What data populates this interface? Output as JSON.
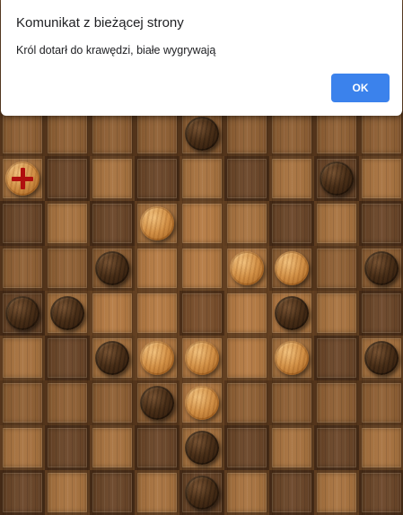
{
  "dialog": {
    "title": "Komunikat z bieżącej strony",
    "message": "Król dotarł do krawędzi, białe wygrywają",
    "ok_label": "OK"
  },
  "board": {
    "size": 9,
    "pieces": [
      {
        "row": 0,
        "col": 4,
        "color": "black"
      },
      {
        "row": 1,
        "col": 0,
        "color": "king"
      },
      {
        "row": 1,
        "col": 7,
        "color": "black"
      },
      {
        "row": 2,
        "col": 3,
        "color": "white"
      },
      {
        "row": 3,
        "col": 2,
        "color": "black"
      },
      {
        "row": 3,
        "col": 5,
        "color": "white"
      },
      {
        "row": 3,
        "col": 6,
        "color": "white"
      },
      {
        "row": 3,
        "col": 8,
        "color": "black"
      },
      {
        "row": 4,
        "col": 0,
        "color": "black"
      },
      {
        "row": 4,
        "col": 1,
        "color": "black"
      },
      {
        "row": 4,
        "col": 6,
        "color": "black"
      },
      {
        "row": 5,
        "col": 2,
        "color": "black"
      },
      {
        "row": 5,
        "col": 3,
        "color": "white"
      },
      {
        "row": 5,
        "col": 4,
        "color": "white"
      },
      {
        "row": 5,
        "col": 6,
        "color": "white"
      },
      {
        "row": 5,
        "col": 8,
        "color": "black"
      },
      {
        "row": 6,
        "col": 3,
        "color": "black"
      },
      {
        "row": 6,
        "col": 4,
        "color": "white"
      },
      {
        "row": 7,
        "col": 4,
        "color": "black"
      },
      {
        "row": 8,
        "col": 4,
        "color": "black"
      }
    ]
  }
}
